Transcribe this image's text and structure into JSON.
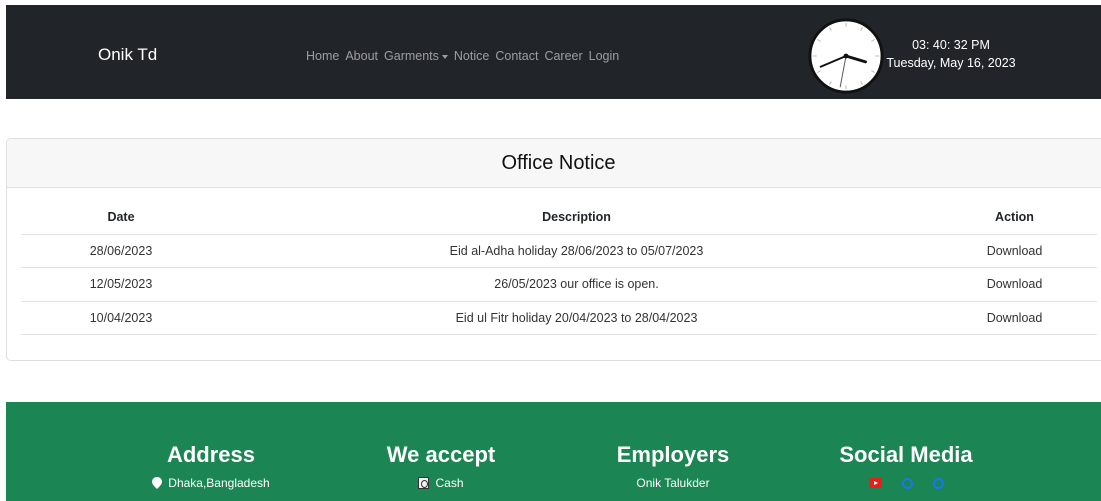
{
  "navbar": {
    "brand": "Onik Td",
    "links": [
      "Home",
      "About",
      "Garments",
      "Notice",
      "Contact",
      "Career",
      "Login"
    ],
    "clock": {
      "time": "03: 40: 32 PM",
      "date": "Tuesday, May 16, 2023"
    }
  },
  "notice": {
    "title": "Office Notice",
    "headers": {
      "date": "Date",
      "description": "Description",
      "action": "Action"
    },
    "rows": [
      {
        "date": "28/06/2023",
        "description": "Eid al-Adha holiday 28/06/2023 to 05/07/2023",
        "action": "Download"
      },
      {
        "date": "12/05/2023",
        "description": "26/05/2023 our office is open.",
        "action": "Download"
      },
      {
        "date": "10/04/2023",
        "description": "Eid ul Fitr holiday 20/04/2023 to 28/04/2023",
        "action": "Download"
      }
    ]
  },
  "footer": {
    "address": {
      "title": "Address",
      "line": "Dhaka,Bangladesh",
      "icon": "map-pin-icon"
    },
    "accept": {
      "title": "We accept",
      "line": "Cash",
      "icon": "cash-icon"
    },
    "employers": {
      "title": "Employers",
      "line": "Onik Talukder"
    },
    "social": {
      "title": "Social Media",
      "icons": [
        "youtube-icon",
        "facebook-icon",
        "linkedin-icon"
      ]
    }
  },
  "colors": {
    "navbar_bg": "#212529",
    "footer_bg": "#1b8653"
  }
}
